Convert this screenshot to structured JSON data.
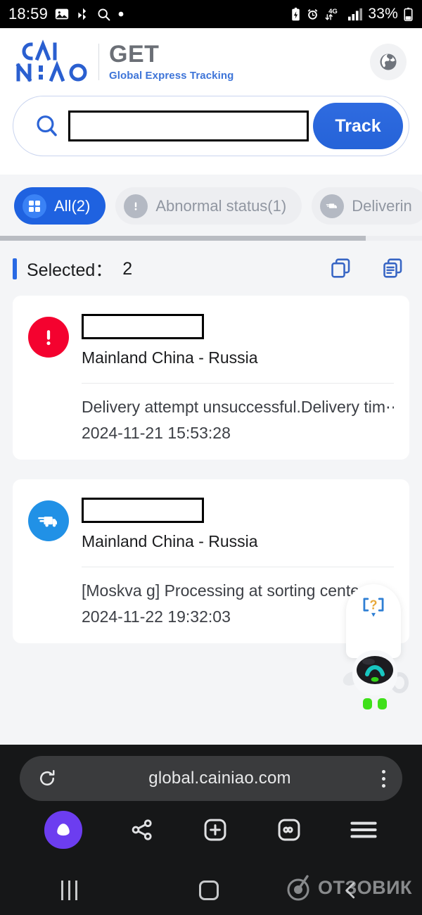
{
  "statusbar": {
    "time": "18:59",
    "battery_percent": "33%",
    "network": "4G",
    "icons": [
      "gallery-icon",
      "bluetooth-audio-icon",
      "search-icon",
      "dot-icon",
      "battery-saver-icon",
      "alarm-icon",
      "network-4g-icon",
      "signal-bars-icon",
      "battery-icon"
    ]
  },
  "header": {
    "brand": "CAINIAO",
    "product_title": "GET",
    "product_subtitle": "Global Express Tracking",
    "language_button": "globe-icon"
  },
  "search": {
    "icon": "search-icon",
    "input_value": "",
    "placeholder": "",
    "track_label": "Track"
  },
  "tabs": [
    {
      "label": "All(2)",
      "icon": "grid-icon",
      "active": true
    },
    {
      "label": "Abnormal status(1)",
      "icon": "alert-icon",
      "active": false
    },
    {
      "label": "Deliverin",
      "icon": "truck-icon",
      "active": false
    }
  ],
  "selection": {
    "label": "Selected：",
    "count": "2",
    "actions": [
      "copy-icon",
      "copy-details-icon"
    ]
  },
  "shipments": [
    {
      "status_icon": "alert-icon",
      "status_color": "#f4022f",
      "tracking_number": "",
      "route": "Mainland China - Russia",
      "status_text": "Delivery attempt unsuccessful.Delivery tim⋯",
      "timestamp": "2024-11-21 15:53:28"
    },
    {
      "status_icon": "truck-icon",
      "status_color": "#2191e6",
      "tracking_number": "",
      "route": "Mainland China - Russia",
      "status_text": "[Moskva g] Processing at sorting cente",
      "timestamp": "2024-11-22 19:32:03"
    }
  ],
  "chat_widget": {
    "bubble_icon": "question-chat-icon",
    "mascot": "cainiao-robot-mascot"
  },
  "browser": {
    "reload_icon": "reload-icon",
    "url": "global.cainiao.com",
    "menu_icon": "more-vertical-icon",
    "toolbar": [
      {
        "name": "alice-assistant-icon"
      },
      {
        "name": "share-icon"
      },
      {
        "name": "new-tab-icon"
      },
      {
        "name": "tabs-infinity-icon"
      },
      {
        "name": "menu-icon"
      }
    ]
  },
  "navbar": {
    "recents_icon": "recents-icon",
    "home_icon": "home-icon",
    "back_icon": "back-icon"
  },
  "watermark": {
    "text": "ОТЗОВИК",
    "icon": "otzovik-logo-icon"
  },
  "colors": {
    "accent_blue": "#1f62e0",
    "track_blue": "#2563d8",
    "alert_red": "#f4022f",
    "truck_blue": "#2191e6",
    "page_bg": "#f4f5f7",
    "chrome_bg": "#161718",
    "alice_purple": "#6c3df0"
  }
}
